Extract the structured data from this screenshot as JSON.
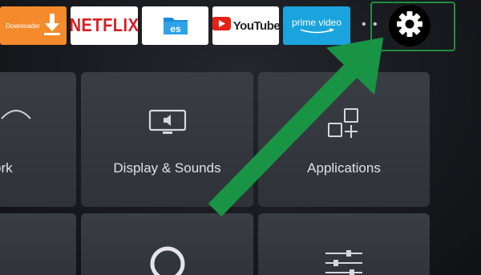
{
  "apps": {
    "downloader": {
      "label": "Downloader",
      "icon": "download-arrow-icon"
    },
    "netflix": {
      "label": "NETFLIX"
    },
    "es_explorer": {
      "icon": "es-file-explorer-icon"
    },
    "youtube": {
      "label": "YouTube",
      "icon": "youtube-play-icon"
    },
    "prime_video": {
      "label": "prime video"
    },
    "more": {
      "label": "• •"
    },
    "settings": {
      "icon": "gear-icon"
    }
  },
  "settings_tiles": {
    "network": {
      "label": "ork",
      "icon": "wifi-icon"
    },
    "display_sounds": {
      "label": "Display & Sounds",
      "icon": "tv-speaker-icon"
    },
    "applications": {
      "label": "Applications",
      "icon": "apps-grid-plus-icon"
    },
    "bottom_middle": {
      "icon": "alexa-ring-icon"
    },
    "bottom_right": {
      "icon": "sliders-icon"
    }
  },
  "colors": {
    "background": "#17191e",
    "tile": "#35383f",
    "highlight_green": "#1e8f3f",
    "downloader_orange": "#f58a2c",
    "netflix_red": "#d81f26",
    "prime_blue": "#1aa3dd"
  }
}
